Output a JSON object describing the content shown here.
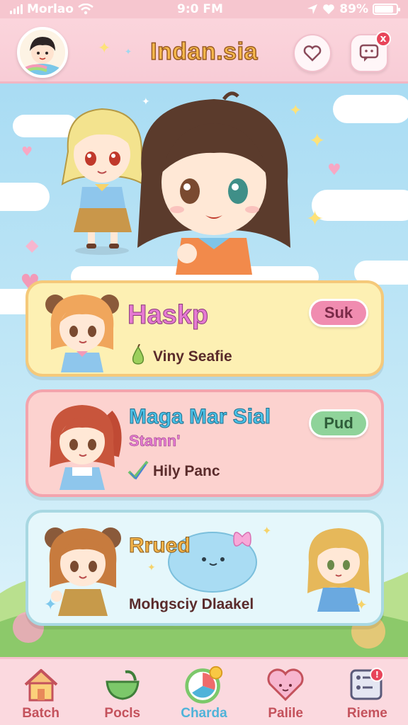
{
  "status_bar": {
    "carrier": "Morlao",
    "time": "9:0 FM",
    "battery_percent": "89%",
    "battery_level": 0.85,
    "icons": [
      "signal-icon",
      "wifi-icon",
      "location-icon",
      "heart-icon",
      "battery-icon"
    ]
  },
  "header": {
    "title": "Indan.sia",
    "title_color": "#f6b84b",
    "buttons": [
      {
        "name": "heart-chat-icon"
      },
      {
        "name": "message-icon",
        "badge": "x"
      }
    ]
  },
  "cards": [
    {
      "title": "Haskp",
      "subtitle": "",
      "line": "Viny Seafie",
      "line_icon": "pear-icon",
      "pill": "Suk",
      "pill_color": "#f08cb0",
      "title_color": "#e67ad2"
    },
    {
      "title": "Maga Mar Sial",
      "subtitle": "Stamn'",
      "line": "Hily Panc",
      "line_icon": "check-icon",
      "pill": "Pud",
      "pill_color": "#8fd39a",
      "title_color": "#4cc2e8"
    },
    {
      "title": "Rrued",
      "subtitle": "",
      "line": "Mohgsciy Dlaakel",
      "line_icon": "",
      "pill": "",
      "title_color": "#f2b44a"
    }
  ],
  "bottom_nav": {
    "items": [
      {
        "label": "Batch",
        "icon": "home-icon"
      },
      {
        "label": "Pocls",
        "icon": "bowl-icon"
      },
      {
        "label": "Charda",
        "icon": "chart-circle-icon",
        "active": true
      },
      {
        "label": "Palile",
        "icon": "heart-face-icon"
      },
      {
        "label": "Rieme",
        "icon": "settings-board-icon",
        "badge": "!"
      }
    ]
  },
  "colors": {
    "header_bg": "#f8ccd6",
    "sky": "#a9dcf3",
    "nav_bg": "#fbd9df",
    "active_nav": "#4fb3d9"
  }
}
